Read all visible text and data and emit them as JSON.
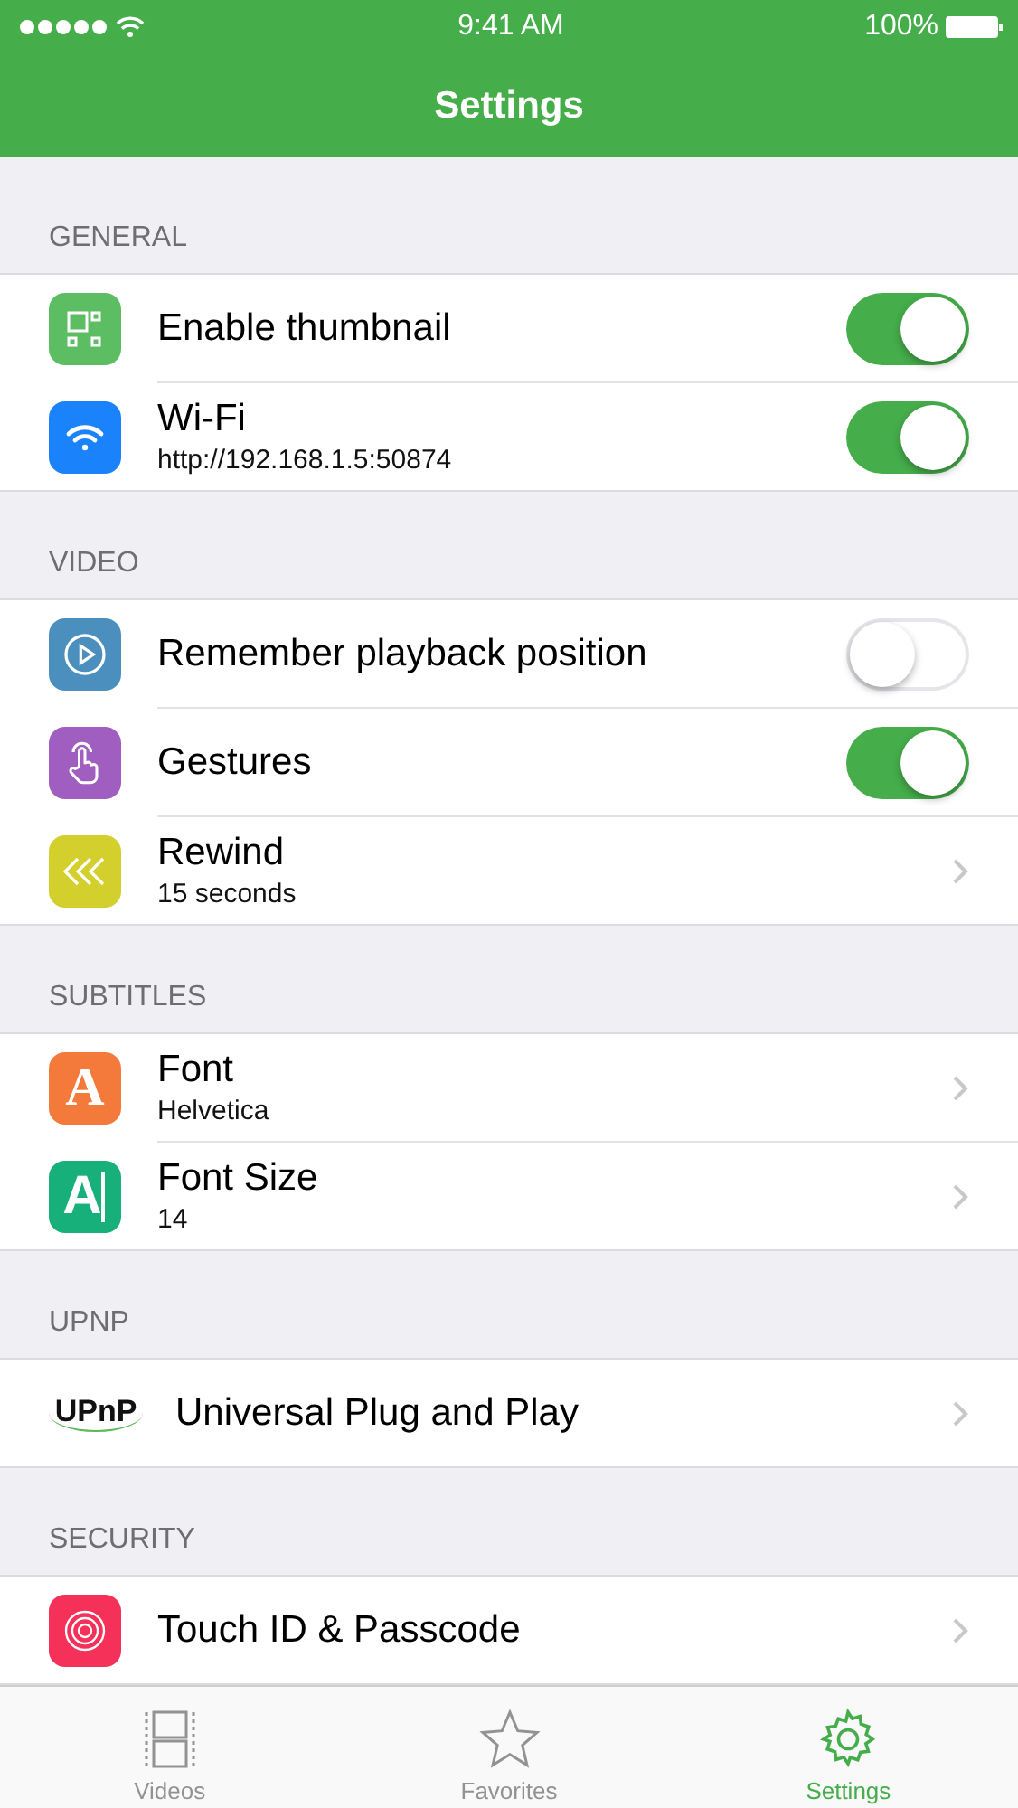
{
  "status_bar": {
    "time": "9:41 AM",
    "battery": "100%"
  },
  "nav": {
    "title": "Settings"
  },
  "sections": [
    {
      "header": "GENERAL",
      "rows": [
        {
          "kind": "toggle",
          "title": "Enable thumbnail",
          "on": true
        },
        {
          "kind": "toggle",
          "title": "Wi-Fi",
          "subtitle": "http://192.168.1.5:50874",
          "on": true
        }
      ]
    },
    {
      "header": "VIDEO",
      "rows": [
        {
          "kind": "toggle",
          "title": "Remember playback position",
          "on": false
        },
        {
          "kind": "toggle",
          "title": "Gestures",
          "on": true
        },
        {
          "kind": "link",
          "title": "Rewind",
          "subtitle": "15 seconds"
        }
      ]
    },
    {
      "header": "SUBTITLES",
      "rows": [
        {
          "kind": "link",
          "title": "Font",
          "subtitle": "Helvetica",
          "icon_text": "A"
        },
        {
          "kind": "link",
          "title": "Font Size",
          "subtitle": "14",
          "icon_text": "A"
        }
      ]
    },
    {
      "header": "UPNP",
      "rows": [
        {
          "kind": "link",
          "title": "Universal Plug and Play",
          "icon_text": "UPnP"
        }
      ]
    },
    {
      "header": "SECURITY",
      "rows": [
        {
          "kind": "link",
          "title": "Touch ID & Passcode"
        }
      ]
    }
  ],
  "tab_bar": [
    {
      "label": "Videos",
      "selected": false
    },
    {
      "label": "Favorites",
      "selected": false
    },
    {
      "label": "Settings",
      "selected": true
    }
  ]
}
